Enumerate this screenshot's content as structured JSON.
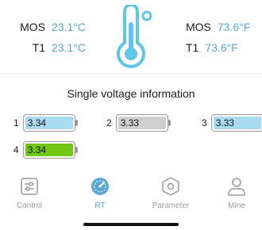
{
  "temperatures": {
    "left": [
      {
        "label": "MOS",
        "value": "23.1°C"
      },
      {
        "label": "T1",
        "value": "23.1°C"
      }
    ],
    "right": [
      {
        "label": "MOS",
        "value": "73.6°F"
      },
      {
        "label": "T1",
        "value": "73.6°F"
      }
    ]
  },
  "section_title": "Single voltage information",
  "cells": [
    {
      "index": "1",
      "voltage": "3.34",
      "state": "blue"
    },
    {
      "index": "2",
      "voltage": "3.33",
      "state": "gray"
    },
    {
      "index": "3",
      "voltage": "3.33",
      "state": "blue"
    },
    {
      "index": "4",
      "voltage": "3.34",
      "state": "green"
    }
  ],
  "nav": {
    "items": [
      {
        "label": "Control",
        "icon": "sliders-icon",
        "active": false
      },
      {
        "label": "RT",
        "icon": "gauge-icon",
        "active": true
      },
      {
        "label": "Parameter",
        "icon": "hexagon-nut-icon",
        "active": false
      },
      {
        "label": "Mine",
        "icon": "person-icon",
        "active": false
      }
    ]
  },
  "colors": {
    "accent": "#5aa6d6",
    "cell_blue": "#a9dbf2",
    "cell_gray": "#cfcfcf",
    "cell_green": "#70c714"
  }
}
